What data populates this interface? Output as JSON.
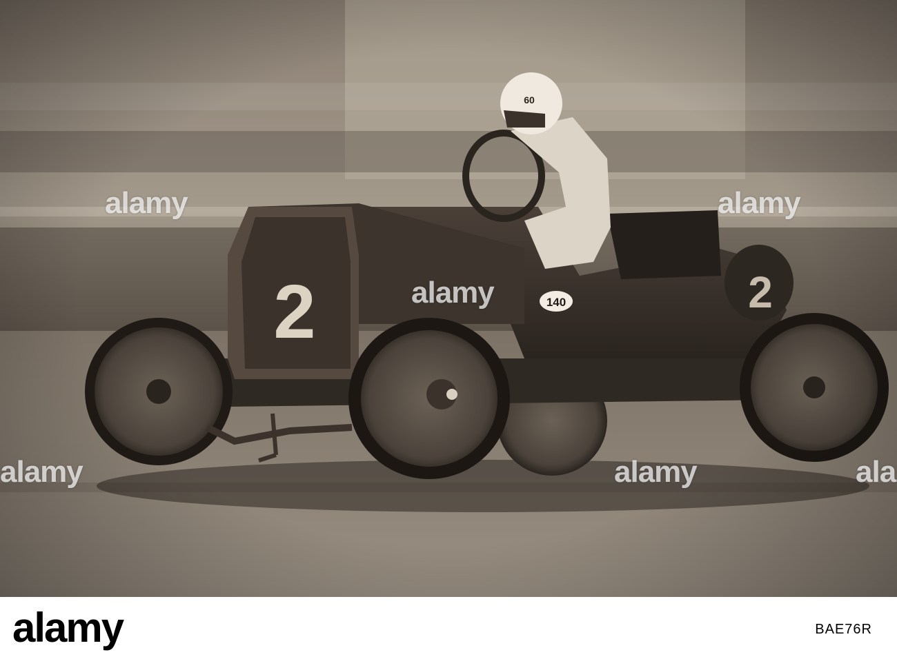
{
  "photo": {
    "tone": "sepia",
    "subject": "vintage-race-car",
    "front_number": "2",
    "side_number": "2",
    "side_plate": "140",
    "helmet_number": "60"
  },
  "watermark": {
    "text": "alamy"
  },
  "footer": {
    "brand": "alamy",
    "image_id": "BAE76R"
  },
  "colors": {
    "sepia_dark": "#2b2520",
    "sepia_mid": "#6e6255",
    "sepia_light": "#c9bfb1",
    "footer_bg": "#ffffff"
  }
}
